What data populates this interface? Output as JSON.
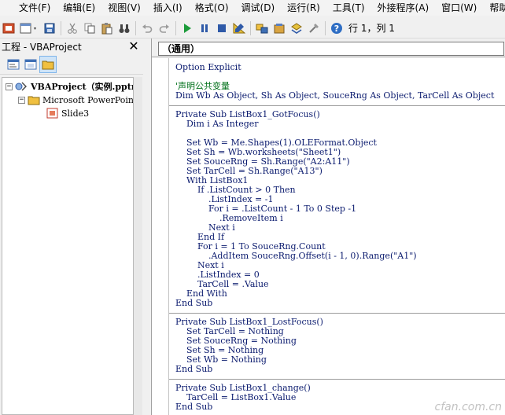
{
  "menubar": {
    "items": [
      "文件(F)",
      "编辑(E)",
      "视图(V)",
      "插入(I)",
      "格式(O)",
      "调试(D)",
      "运行(R)",
      "工具(T)",
      "外接程序(A)",
      "窗口(W)",
      "帮助"
    ]
  },
  "toolbar": {
    "status": "行 1，列 1"
  },
  "project": {
    "title": "工程 - VBAProject",
    "close_glyph": "✕",
    "tree": {
      "root": "VBAProject（实例.pptm）",
      "folder": "Microsoft PowerPoint 对象",
      "item": "Slide3"
    }
  },
  "code": {
    "object": "（通用）",
    "lines": [
      "Option Explicit",
      "",
      "'声明公共变量",
      "Dim Wb As Object, Sh As Object, SouceRng As Object, TarCell As Object",
      "",
      "Private Sub ListBox1_GotFocus()",
      "    Dim i As Integer",
      "",
      "    Set Wb = Me.Shapes(1).OLEFormat.Object",
      "    Set Sh = Wb.worksheets(\"Sheet1\")",
      "    Set SouceRng = Sh.Range(\"A2:A11\")",
      "    Set TarCell = Sh.Range(\"A13\")",
      "    With ListBox1",
      "        If .ListCount > 0 Then",
      "            .ListIndex = -1",
      "            For i = .ListCount - 1 To 0 Step -1",
      "                .RemoveItem i",
      "            Next i",
      "        End If",
      "        For i = 1 To SouceRng.Count",
      "            .AddItem SouceRng.Offset(i - 1, 0).Range(\"A1\")",
      "        Next i",
      "        .ListIndex = 0",
      "        TarCell = .Value",
      "    End With",
      "End Sub",
      "",
      "Private Sub ListBox1_LostFocus()",
      "    Set TarCell = Nothing",
      "    Set SouceRng = Nothing",
      "    Set Sh = Nothing",
      "    Set Wb = Nothing",
      "End Sub",
      "",
      "Private Sub ListBox1_change()",
      "    TarCell = ListBox1.Value",
      "End Sub"
    ],
    "comment_lines": [
      2
    ],
    "separator_before_lines": [
      5,
      27,
      34
    ]
  },
  "watermark": "cfan.com.cn"
}
